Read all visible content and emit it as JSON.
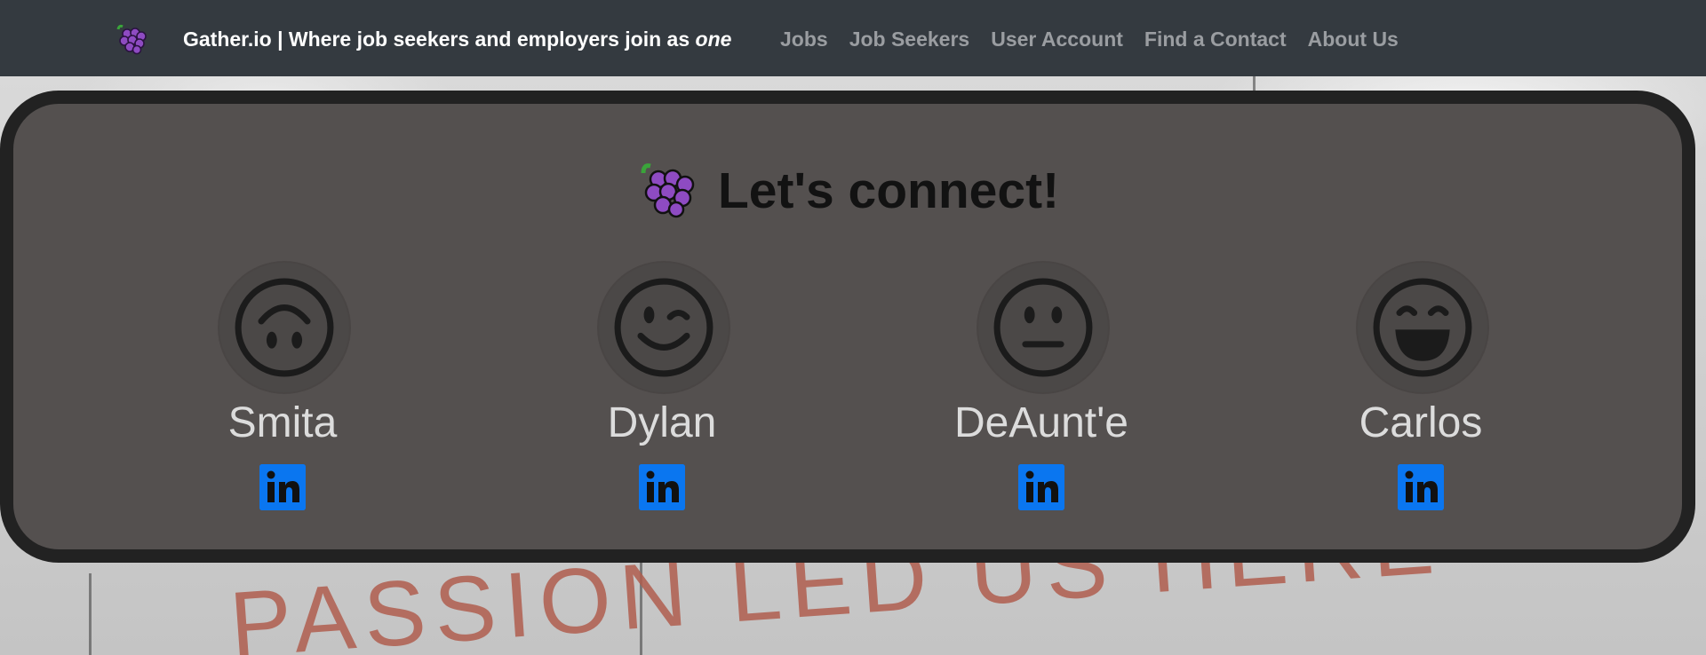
{
  "navbar": {
    "logo_icon": "grapes-icon",
    "brand_text": "Gather.io | Where job seekers and employers join as ",
    "brand_emphasis": "one",
    "links": [
      {
        "label": "Jobs"
      },
      {
        "label": "Job Seekers"
      },
      {
        "label": "User Account"
      },
      {
        "label": "Find a Contact"
      },
      {
        "label": "About Us"
      }
    ]
  },
  "main": {
    "title_icon": "grapes-icon",
    "title": "Let's connect!",
    "contacts": [
      {
        "name": "Smita",
        "avatar_icon": "upside-down-face-icon",
        "social_icon": "linkedin-icon"
      },
      {
        "name": "Dylan",
        "avatar_icon": "winking-face-icon",
        "social_icon": "linkedin-icon"
      },
      {
        "name": "DeAunt'e",
        "avatar_icon": "neutral-face-icon",
        "social_icon": "linkedin-icon"
      },
      {
        "name": "Carlos",
        "avatar_icon": "grinning-face-icon",
        "social_icon": "linkedin-icon"
      }
    ]
  },
  "colors": {
    "navbar_bg": "#343a40",
    "card_bg": "#54504f",
    "card_border": "#222222",
    "linkedin_blue": "#0a76f0"
  },
  "background": {
    "photo_text": "PASSION LED US HERE"
  }
}
